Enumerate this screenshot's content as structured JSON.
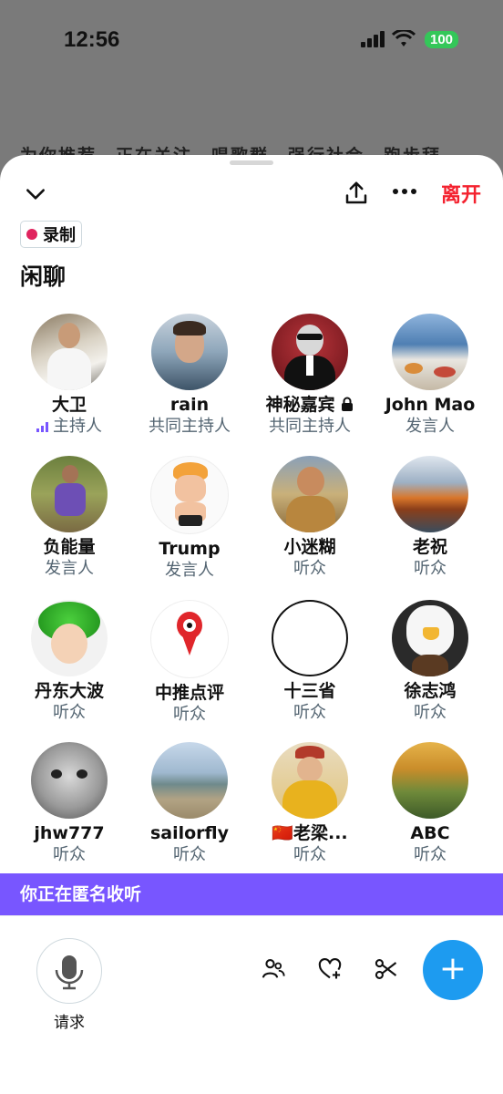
{
  "status_bar": {
    "time": "12:56",
    "battery": "100"
  },
  "background": {
    "tabs_text": "为你推荐　正在关注　唱歌群　强行社会　跑步拜"
  },
  "header": {
    "leave_label": "离开",
    "recording_label": "录制"
  },
  "space": {
    "title": "闲聊"
  },
  "participants": [
    {
      "name": "大卫",
      "role": "主持人",
      "speaking": true
    },
    {
      "name": "rain",
      "role": "共同主持人"
    },
    {
      "name": "神秘嘉宾",
      "role": "共同主持人",
      "locked": true
    },
    {
      "name": "John Mao",
      "role": "发言人"
    },
    {
      "name": "负能量",
      "role": "发言人"
    },
    {
      "name": "Trump",
      "role": "发言人"
    },
    {
      "name": "小迷糊",
      "role": "听众"
    },
    {
      "name": "老祝",
      "role": "听众"
    },
    {
      "name": "丹东大波",
      "role": "听众"
    },
    {
      "name": "中推点评",
      "role": "听众"
    },
    {
      "name": "十三省",
      "role": "听众"
    },
    {
      "name": "徐志鸿",
      "role": "听众"
    },
    {
      "name": "jhw777",
      "role": "听众"
    },
    {
      "name": "sailorfly",
      "role": "听众"
    },
    {
      "name": "🇨🇳老梁...",
      "role": "听众"
    },
    {
      "name": "ABC",
      "role": "听众"
    }
  ],
  "banner": {
    "text": "你正在匿名收听"
  },
  "footer": {
    "request_label": "请求",
    "fab_symbol": "+"
  },
  "colors": {
    "accent": "#1d9bf0",
    "leave": "#f4212e",
    "banner": "#7856ff",
    "record_dot": "#e0245e"
  }
}
